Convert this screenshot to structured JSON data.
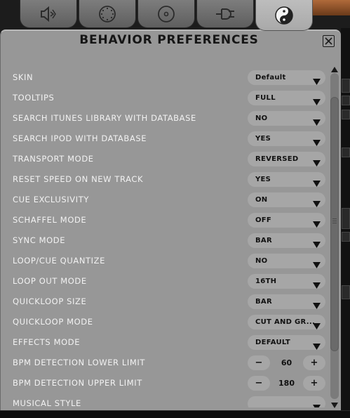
{
  "tabs": [
    {
      "icon": "speaker-icon"
    },
    {
      "icon": "dial-icon"
    },
    {
      "icon": "disc-icon"
    },
    {
      "icon": "plug-icon"
    },
    {
      "icon": "yin-yang-icon",
      "active": true
    }
  ],
  "panel": {
    "title": "BEHAVIOR PREFERENCES"
  },
  "settings": [
    {
      "label": "SKIN",
      "value": "Default"
    },
    {
      "label": "TOOLTIPS",
      "value": "FULL"
    },
    {
      "label": "SEARCH ITUNES LIBRARY WITH DATABASE",
      "value": "NO"
    },
    {
      "label": "SEARCH IPOD WITH DATABASE",
      "value": "YES"
    },
    {
      "label": "TRANSPORT MODE",
      "value": "REVERSED"
    },
    {
      "label": "RESET SPEED ON NEW TRACK",
      "value": "YES"
    },
    {
      "label": "CUE EXCLUSIVITY",
      "value": "ON"
    },
    {
      "label": "SCHAFFEL MODE",
      "value": "OFF"
    },
    {
      "label": "SYNC MODE",
      "value": "BAR"
    },
    {
      "label": "LOOP/CUE QUANTIZE",
      "value": "NO"
    },
    {
      "label": "LOOP OUT MODE",
      "value": "16TH"
    },
    {
      "label": "QUICKLOOP SIZE",
      "value": "BAR"
    },
    {
      "label": "QUICKLOOP MODE",
      "value": "CUT AND GR..."
    },
    {
      "label": "EFFECTS MODE",
      "value": "DEFAULT"
    },
    {
      "label": "BPM DETECTION LOWER LIMIT",
      "value": "60",
      "stepper": true
    },
    {
      "label": "BPM DETECTION UPPER LIMIT",
      "value": "180",
      "stepper": true
    },
    {
      "label": "MUSICAL STYLE",
      "value": ""
    }
  ],
  "stepper": {
    "minus": "−",
    "plus": "+"
  },
  "colors": {
    "panel": "#979797",
    "control": "#a6a6a6",
    "label": "#f2f2f2"
  }
}
